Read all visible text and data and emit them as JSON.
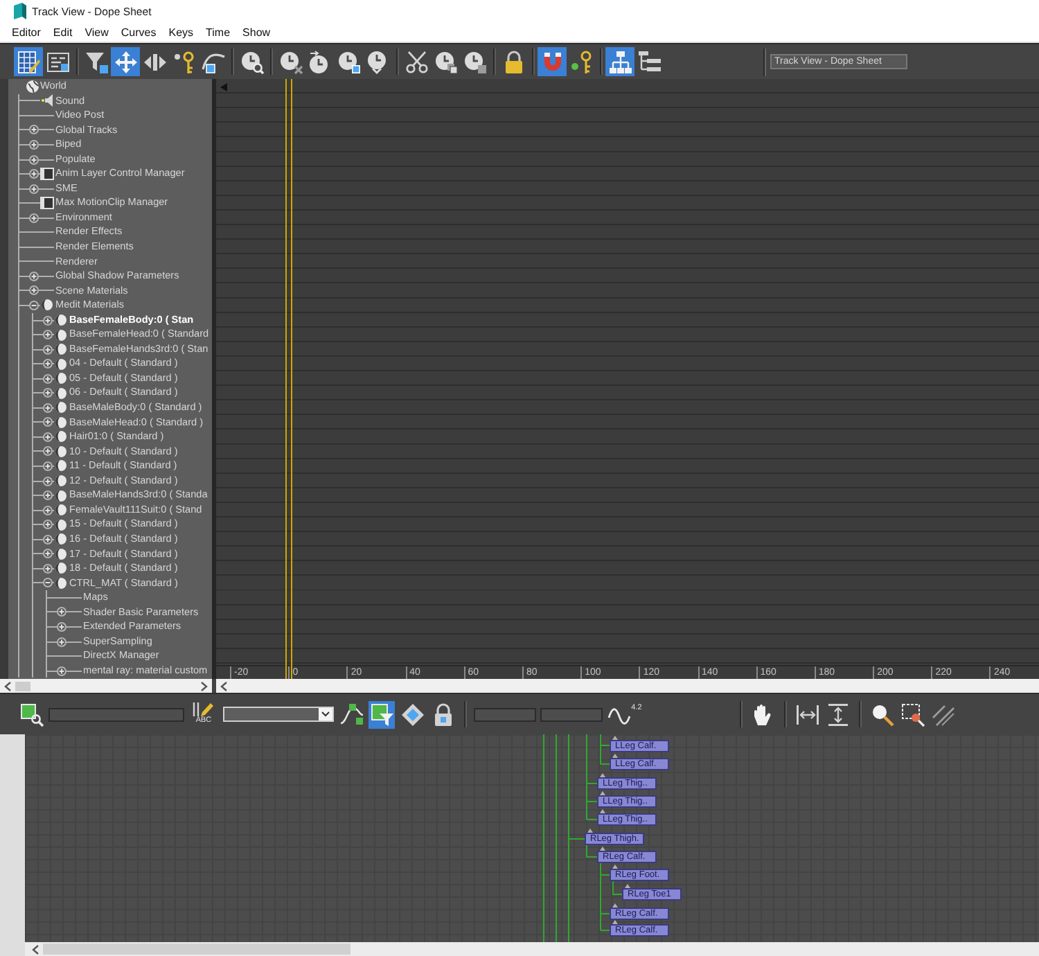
{
  "window": {
    "title": "Track View - Dope Sheet"
  },
  "menu": [
    "Editor",
    "Edit",
    "View",
    "Curves",
    "Keys",
    "Time",
    "Show"
  ],
  "toolbar": {
    "groups": [
      [
        {
          "kind": "dopesheet",
          "selected": true
        },
        {
          "kind": "editlist",
          "selected": false
        }
      ],
      [
        {
          "kind": "filter",
          "selected": false
        },
        {
          "kind": "move",
          "selected": true
        },
        {
          "kind": "slide",
          "selected": false
        },
        {
          "kind": "insert",
          "selected": false
        },
        {
          "kind": "scale",
          "selected": false
        }
      ],
      [
        {
          "kind": "zoomtime",
          "selected": false
        }
      ],
      [
        {
          "kind": "deletetime",
          "selected": false
        },
        {
          "kind": "inserttime",
          "selected": false
        },
        {
          "kind": "scaletime",
          "selected": false
        },
        {
          "kind": "reversetime",
          "selected": false
        }
      ],
      [
        {
          "kind": "cut",
          "selected": false
        },
        {
          "kind": "copy",
          "selected": false
        },
        {
          "kind": "paste",
          "selected": false
        }
      ],
      [
        {
          "kind": "lock",
          "selected": false
        }
      ],
      [
        {
          "kind": "snap",
          "selected": true
        },
        {
          "kind": "keyable",
          "selected": false
        }
      ],
      [
        {
          "kind": "hierarchy",
          "selected": true
        },
        {
          "kind": "outline",
          "selected": false
        }
      ]
    ],
    "view_name": "Track View - Dope Sheet"
  },
  "tree": {
    "items": [
      {
        "label": "World",
        "kind": "root",
        "children": [
          {
            "label": "Sound",
            "kind": "audio"
          },
          {
            "label": "Video Post",
            "kind": "track"
          },
          {
            "label": "Global Tracks",
            "kind": "track",
            "expanded": false
          },
          {
            "label": "Biped",
            "kind": "track",
            "expanded": false
          },
          {
            "label": "Populate",
            "kind": "track",
            "expanded": false
          },
          {
            "label": "Anim Layer Control Manager",
            "kind": "manager",
            "expanded": false
          },
          {
            "label": "SME",
            "kind": "track",
            "expanded": false
          },
          {
            "label": "Max MotionClip Manager",
            "kind": "manager"
          },
          {
            "label": "Environment",
            "kind": "track",
            "expanded": false
          },
          {
            "label": "Render Effects",
            "kind": "track"
          },
          {
            "label": "Render Elements",
            "kind": "track"
          },
          {
            "label": "Renderer",
            "kind": "track"
          },
          {
            "label": "Global Shadow Parameters",
            "kind": "track",
            "expanded": false
          },
          {
            "label": "Scene Materials",
            "kind": "track",
            "expanded": false
          },
          {
            "label": "Medit Materials",
            "kind": "material",
            "expanded": true,
            "children": [
              {
                "label": "BaseFemaleBody:0 ( Stan",
                "kind": "material",
                "expanded": false,
                "active": true
              },
              {
                "label": "BaseFemaleHead:0 ( Standard",
                "kind": "material",
                "expanded": false,
                "active": false
              },
              {
                "label": "BaseFemaleHands3rd:0 ( Stan",
                "kind": "material",
                "expanded": false,
                "active": false
              },
              {
                "label": "04 - Default ( Standard )",
                "kind": "material",
                "expanded": false,
                "active": false
              },
              {
                "label": "05 - Default ( Standard )",
                "kind": "material",
                "expanded": false,
                "active": false
              },
              {
                "label": "06 - Default ( Standard )",
                "kind": "material",
                "expanded": false,
                "active": false
              },
              {
                "label": "BaseMaleBody:0 ( Standard )",
                "kind": "material",
                "expanded": false,
                "active": false
              },
              {
                "label": "BaseMaleHead:0 ( Standard )",
                "kind": "material",
                "expanded": false,
                "active": false
              },
              {
                "label": "Hair01:0 ( Standard )",
                "kind": "material",
                "expanded": false,
                "active": false
              },
              {
                "label": "10 - Default ( Standard )",
                "kind": "material",
                "expanded": false,
                "active": false
              },
              {
                "label": "11 - Default ( Standard )",
                "kind": "material",
                "expanded": false,
                "active": false
              },
              {
                "label": "12 - Default ( Standard )",
                "kind": "material",
                "expanded": false,
                "active": false
              },
              {
                "label": "BaseMaleHands3rd:0 ( Standa",
                "kind": "material",
                "expanded": false,
                "active": false
              },
              {
                "label": "FemaleVault111Suit:0 ( Stand",
                "kind": "material",
                "expanded": false,
                "active": false
              },
              {
                "label": "15 - Default ( Standard )",
                "kind": "material",
                "expanded": false,
                "active": false
              },
              {
                "label": "16 - Default ( Standard )",
                "kind": "material",
                "expanded": false,
                "active": false
              },
              {
                "label": "17 - Default ( Standard )",
                "kind": "material",
                "expanded": false,
                "active": false
              },
              {
                "label": "18 - Default ( Standard )",
                "kind": "material",
                "expanded": false,
                "active": false
              },
              {
                "label": "CTRL_MAT ( Standard )",
                "kind": "material",
                "expanded": true,
                "active": false,
                "children": [
                  {
                    "label": "Maps",
                    "kind": "track"
                  },
                  {
                    "label": "Shader Basic Parameters",
                    "kind": "track",
                    "expanded": false
                  },
                  {
                    "label": "Extended Parameters",
                    "kind": "track",
                    "expanded": false
                  },
                  {
                    "label": "SuperSampling",
                    "kind": "track",
                    "expanded": false
                  },
                  {
                    "label": "DirectX Manager",
                    "kind": "track"
                  },
                  {
                    "label": "mental ray: material custom",
                    "kind": "track",
                    "expanded": false
                  }
                ]
              }
            ]
          }
        ]
      }
    ]
  },
  "dope_sheet": {
    "time_slider": {
      "level": 0.083
    },
    "ruler_labels": [
      "-20",
      "0",
      "20",
      "40",
      "60",
      "80",
      "100",
      "120",
      "140",
      "160",
      "180",
      "200",
      "220",
      "240"
    ]
  },
  "bottom_toolbar": {
    "groups": [
      [
        {
          "kind": "keyfilter",
          "selected": false
        },
        {
          "kind": "namefield"
        },
        {
          "kind": "rename",
          "caption": "ABC",
          "selected": false
        },
        {
          "kind": "dropdown"
        },
        {
          "kind": "curves",
          "selected": false
        },
        {
          "kind": "selectfilter",
          "selected": true
        },
        {
          "kind": "tangents",
          "selected": false
        },
        {
          "kind": "lock",
          "selected": false
        }
      ],
      [
        {
          "kind": "numberfield"
        },
        {
          "kind": "numberfield"
        },
        {
          "kind": "values",
          "caption": "4.2",
          "selected": false
        }
      ],
      [
        {
          "kind": "pan",
          "selected": false
        }
      ],
      [
        {
          "kind": "fithorizontal",
          "selected": false
        },
        {
          "kind": "fitvertical",
          "selected": false
        }
      ],
      [
        {
          "kind": "zoom",
          "selected": false
        },
        {
          "kind": "zoomregion",
          "selected": false
        },
        {
          "kind": "zoomvalues",
          "selected": false
        }
      ]
    ]
  },
  "schematic": {
    "nodes": [
      {
        "label": "LLeg Calf."
      },
      {
        "label": "LLeg Calf."
      },
      {
        "label": "LLeg Thig.."
      },
      {
        "label": "LLeg Thig.."
      },
      {
        "label": "LLeg Thig.."
      },
      {
        "label": "RLeg Thigh."
      },
      {
        "label": "RLeg Calf."
      },
      {
        "label": "RLeg Foot."
      },
      {
        "label": "RLeg Toe1"
      },
      {
        "label": "RLeg Calf."
      },
      {
        "label": "RLeg Calf."
      }
    ]
  }
}
